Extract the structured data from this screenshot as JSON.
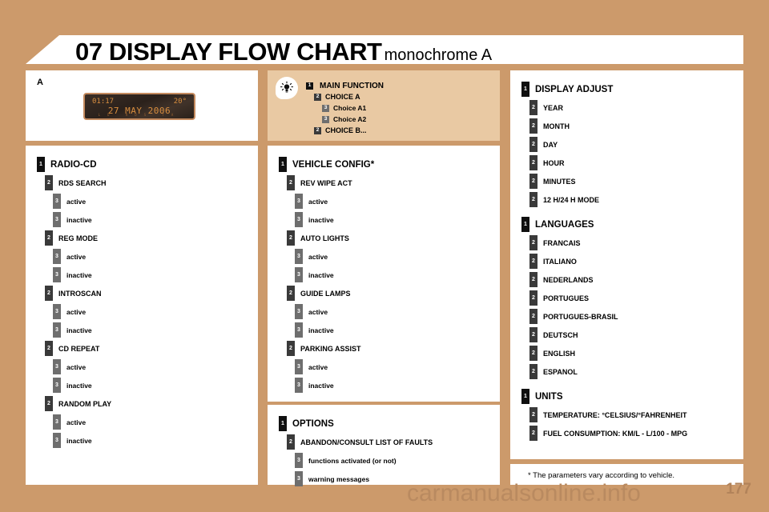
{
  "header": {
    "chapter": "07",
    "title": "07 DISPLAY FLOW CHART",
    "subtitle": "monochrome A"
  },
  "colors": {
    "page_background": "#cc9a6b",
    "panel_background": "#ffffff",
    "legend_background": "#e9c9a3",
    "badge_level1": "#101010",
    "badge_level2": "#3a3a3a",
    "badge_level3": "#6e6e6e",
    "lcd_text": "#d98e3f",
    "watermark": "#b98a60"
  },
  "panel_a": {
    "letter": "A",
    "display": {
      "time": "01:17",
      "temperature": "20°",
      "date": "27 MAY 2006",
      "indicators": "LD RDS TA"
    }
  },
  "legend": {
    "icon": "brightness-bulb-icon",
    "rows": [
      {
        "level": 1,
        "label": "MAIN FUNCTION"
      },
      {
        "level": 2,
        "label": "CHOICE A"
      },
      {
        "level": 3,
        "label": "Choice A1"
      },
      {
        "level": 3,
        "label": "Choice A2"
      },
      {
        "level": 2,
        "label": "CHOICE B..."
      }
    ]
  },
  "radio_cd": {
    "rows": [
      {
        "level": 1,
        "label": "RADIO-CD"
      },
      {
        "level": 2,
        "label": "RDS SEARCH"
      },
      {
        "level": 3,
        "label": "active"
      },
      {
        "level": 3,
        "label": "inactive"
      },
      {
        "level": 2,
        "label": "REG MODE"
      },
      {
        "level": 3,
        "label": "active"
      },
      {
        "level": 3,
        "label": "inactive"
      },
      {
        "level": 2,
        "label": "INTROSCAN"
      },
      {
        "level": 3,
        "label": "active"
      },
      {
        "level": 3,
        "label": "inactive"
      },
      {
        "level": 2,
        "label": "CD REPEAT"
      },
      {
        "level": 3,
        "label": "active"
      },
      {
        "level": 3,
        "label": "inactive"
      },
      {
        "level": 2,
        "label": "RANDOM PLAY"
      },
      {
        "level": 3,
        "label": "active"
      },
      {
        "level": 3,
        "label": "inactive"
      }
    ]
  },
  "vehicle_config": {
    "rows": [
      {
        "level": 1,
        "label": "VEHICLE CONFIG*"
      },
      {
        "level": 2,
        "label": "REV WIPE ACT"
      },
      {
        "level": 3,
        "label": "active"
      },
      {
        "level": 3,
        "label": "inactive"
      },
      {
        "level": 2,
        "label": "AUTO LIGHTS"
      },
      {
        "level": 3,
        "label": "active"
      },
      {
        "level": 3,
        "label": "inactive"
      },
      {
        "level": 2,
        "label": "GUIDE LAMPS"
      },
      {
        "level": 3,
        "label": "active"
      },
      {
        "level": 3,
        "label": "inactive"
      },
      {
        "level": 2,
        "label": "PARKING ASSIST"
      },
      {
        "level": 3,
        "label": "active"
      },
      {
        "level": 3,
        "label": "inactive"
      }
    ]
  },
  "options": {
    "rows": [
      {
        "level": 1,
        "label": "OPTIONS"
      },
      {
        "level": 2,
        "label": "ABANDON/CONSULT LIST OF FAULTS"
      },
      {
        "level": 3,
        "label": "functions activated (or not)"
      },
      {
        "level": 3,
        "label": "warning messages"
      }
    ]
  },
  "display_adjust": {
    "rows": [
      {
        "level": 1,
        "label": "DISPLAY ADJUST"
      },
      {
        "level": 2,
        "label": "YEAR"
      },
      {
        "level": 2,
        "label": "MONTH"
      },
      {
        "level": 2,
        "label": "DAY"
      },
      {
        "level": 2,
        "label": "HOUR"
      },
      {
        "level": 2,
        "label": "MINUTES"
      },
      {
        "level": 2,
        "label": "12 H/24 H MODE"
      }
    ]
  },
  "languages": {
    "rows": [
      {
        "level": 1,
        "label": "LANGUAGES"
      },
      {
        "level": 2,
        "label": "FRANCAIS"
      },
      {
        "level": 2,
        "label": "ITALIANO"
      },
      {
        "level": 2,
        "label": "NEDERLANDS"
      },
      {
        "level": 2,
        "label": "PORTUGUES"
      },
      {
        "level": 2,
        "label": "PORTUGUES-BRASIL"
      },
      {
        "level": 2,
        "label": "DEUTSCH"
      },
      {
        "level": 2,
        "label": "ENGLISH"
      },
      {
        "level": 2,
        "label": "ESPANOL"
      }
    ]
  },
  "units": {
    "rows": [
      {
        "level": 1,
        "label": "UNITS"
      },
      {
        "level": 2,
        "label": "TEMPERATURE: °CELSIUS/°FAHRENHEIT"
      },
      {
        "level": 2,
        "label": "FUEL CONSUMPTION: KM/L - L/100 - MPG"
      }
    ]
  },
  "footnote": {
    "text": "* The parameters vary according to vehicle."
  },
  "footer": {
    "watermark": "carmanualsonline.info",
    "page_number": "177"
  }
}
